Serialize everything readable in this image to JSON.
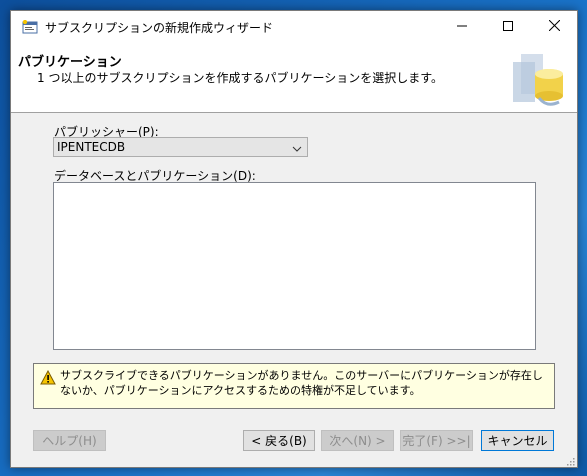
{
  "window": {
    "title": "サブスクリプションの新規作成ウィザード",
    "icon": "wizard-app-icon",
    "controls": {
      "minimize": "minimize-icon",
      "maximize": "maximize-icon",
      "close": "close-icon"
    }
  },
  "header": {
    "title": "パブリケーション",
    "description": "1 つ以上のサブスクリプションを作成するパブリケーションを選択します。",
    "graphic": "database-publication-graphic"
  },
  "publisher": {
    "label": "パブリッシャー(P):",
    "selected": "IPENTECDB"
  },
  "databases": {
    "label": "データベースとパブリケーション(D):",
    "items": []
  },
  "warning": {
    "icon": "warning-icon",
    "text": "サブスクライブできるパブリケーションがありません。このサーバーにパブリケーションが存在しないか、パブリケーションにアクセスするための特権が不足しています。"
  },
  "buttons": {
    "help": "ヘルプ(H)",
    "back": "< 戻る(B)",
    "next": "次へ(N) >",
    "finish": "完了(F) >>|",
    "cancel": "キャンセル"
  },
  "colors": {
    "warning_bg": "#ffffe1",
    "accent": "#0078d7"
  }
}
